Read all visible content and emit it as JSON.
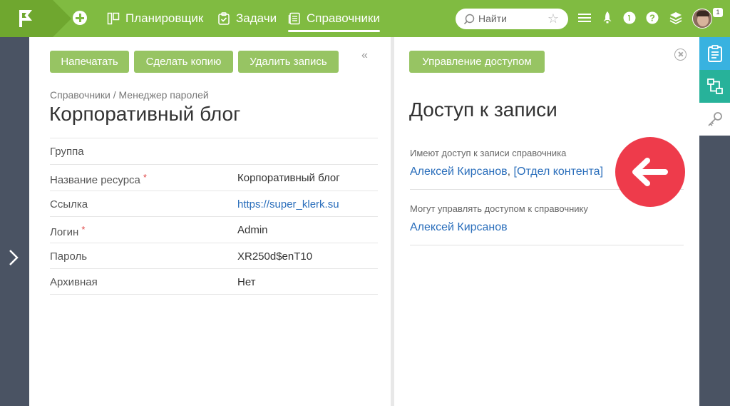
{
  "topbar": {
    "nav": [
      {
        "label": "Планировщик",
        "icon": "planner-icon"
      },
      {
        "label": "Задачи",
        "icon": "tasks-icon"
      },
      {
        "label": "Справочники",
        "icon": "directories-icon",
        "active": true
      }
    ],
    "search_placeholder": "Найти",
    "notification_count": "1",
    "accent_color": "#80bb41"
  },
  "left_panel": {
    "buttons": {
      "print": "Напечатать",
      "copy": "Сделать копию",
      "delete": "Удалить запись"
    },
    "collapse_icon": "«",
    "breadcrumb": "Справочники / Менеджер паролей",
    "title": "Корпоративный блог",
    "fields": [
      {
        "label": "Группа",
        "value": "",
        "required": false
      },
      {
        "label": "Название ресурса",
        "value": "Корпоративный блог",
        "required": true
      },
      {
        "label": "Ссылка",
        "value": "https://super_klerk.su",
        "required": false,
        "is_link": true
      },
      {
        "label": "Логин",
        "value": "Admin",
        "required": true
      },
      {
        "label": "Пароль",
        "value": "XR250d$enT10",
        "required": false
      },
      {
        "label": "Архивная",
        "value": "Нет",
        "required": false
      }
    ]
  },
  "right_panel": {
    "manage_button": "Управление доступом",
    "title": "Доступ к записи",
    "section1_label": "Имеют доступ к записи справочника",
    "section1_user": "Алексей Кирсанов",
    "section1_sep": ", ",
    "section1_dept": "[Отдел контента]",
    "section2_label": "Могут управлять доступом к справочнику",
    "section2_user": "Алексей Кирсанов"
  }
}
